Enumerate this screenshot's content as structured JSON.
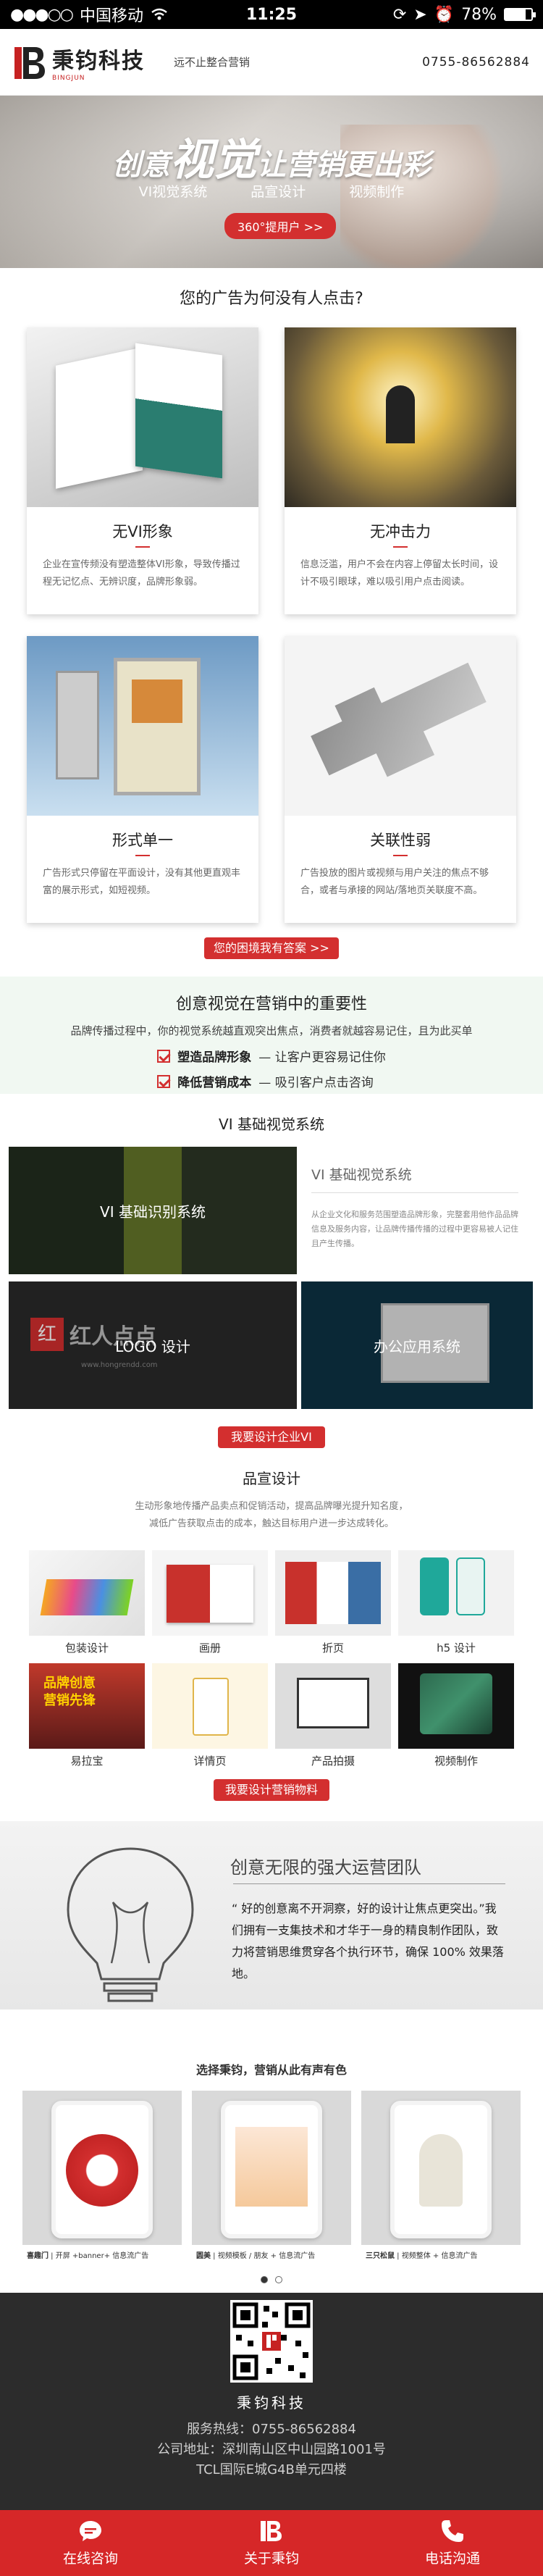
{
  "status_bar": {
    "carrier": "中国移动",
    "time": "11:25",
    "battery": "78%",
    "battery_level": 0.78
  },
  "header": {
    "logo_name": "秉钧科技",
    "logo_sub": "BINGJUN",
    "slogan": "远不止整合营销",
    "hotline": "0755-86562884"
  },
  "hero": {
    "title_pre": "创意",
    "title_big": "视觉",
    "title_post": "让营销更出彩",
    "items": [
      "VI视觉系统",
      "品宣设计",
      "视频制作"
    ],
    "button": "360°提用户 >>"
  },
  "problems": {
    "title": "您的广告为何没有人点击?",
    "cards": [
      {
        "title": "无VI形象",
        "desc": "企业在宣传频没有塑造整体VI形象，导致传播过程无记忆点、无辨识度，品牌形象弱。"
      },
      {
        "title": "无冲击力",
        "desc": "信息泛滥，用户不会在内容上停留太长时间，设计不吸引眼球，难以吸引用户点击阅读。"
      },
      {
        "title": "形式单一",
        "desc": "广告形式只停留在平面设计，没有其他更直观丰富的展示形式，如短视频。"
      },
      {
        "title": "关联性弱",
        "desc": "广告投放的图片或视频与用户关注的焦点不够合，或者与承接的网站/落地页关联度不高。"
      }
    ],
    "button": "您的困境我有答案 >>"
  },
  "importance": {
    "title": "创意视觉在营销中的重要性",
    "desc": "品牌传播过程中，你的视觉系统越直观突出焦点，消费者就越容易记住，且为此买单",
    "checks": [
      {
        "bold": "塑造品牌形象",
        "rest": " — 让客户更容易记住你"
      },
      {
        "bold": "降低营销成本",
        "rest": " — 吸引客户点击咨询"
      }
    ]
  },
  "vi": {
    "title": "VI 基础视觉系统",
    "tiles": [
      "VI 基础识别系统",
      "LOGO 设计",
      "办公应用系统"
    ],
    "side_title": "VI 基础视觉系统",
    "side_desc": "从企业文化和服务范围塑造品牌形象，完整套用他作品品牌信息及服务内容，让品牌传播传播的过程中更容易被人记住且产生传播。",
    "logo_red": "红人点点",
    "logo_url": "www.hongrendd.com",
    "button": "我要设计企业VI"
  },
  "design": {
    "title": "品宣设计",
    "desc1": "生动形象地传播产品卖点和促销活动，提高品牌曝光提升知名度，",
    "desc2": "减低广告获取点击的成本，触达目标用户进一步达成转化。",
    "items": [
      "包装设计",
      "画册",
      "折页",
      "h5 设计",
      "易拉宝",
      "详情页",
      "产品拍摄",
      "视频制作"
    ],
    "button": "我要设计营销物料"
  },
  "team": {
    "title": "创意无限的强大运营团队",
    "desc": "“ 好的创意离不开洞察，好的设计让焦点更突出。”我们拥有一支集技术和才华于一身的精良制作团队，致力将营销思维贯穿各个执行环节，确保 100% 效果落地。"
  },
  "cases": {
    "title": "选择秉钧，营销从此有声有色",
    "items": [
      {
        "bold": "喜趣门",
        "rest": " | 开屏 +banner+ 信息流广告"
      },
      {
        "bold": "圆美",
        "rest": " | 视频模板 / 朋友 + 信息流广告"
      },
      {
        "bold": "三只松鼠",
        "rest": " | 视频整体 + 信息流广告"
      }
    ]
  },
  "footer": {
    "company": "秉钧科技",
    "lines": [
      "服务热线：0755-86562884",
      "公司地址：深圳南山区中山园路1001号",
      "TCL国际E城G4B单元四楼"
    ]
  },
  "tabbar": [
    "在线咨询",
    "关于秉钧",
    "电话沟通"
  ],
  "colors": {
    "accent": "#d62728",
    "dark": "#2c2c2c"
  }
}
